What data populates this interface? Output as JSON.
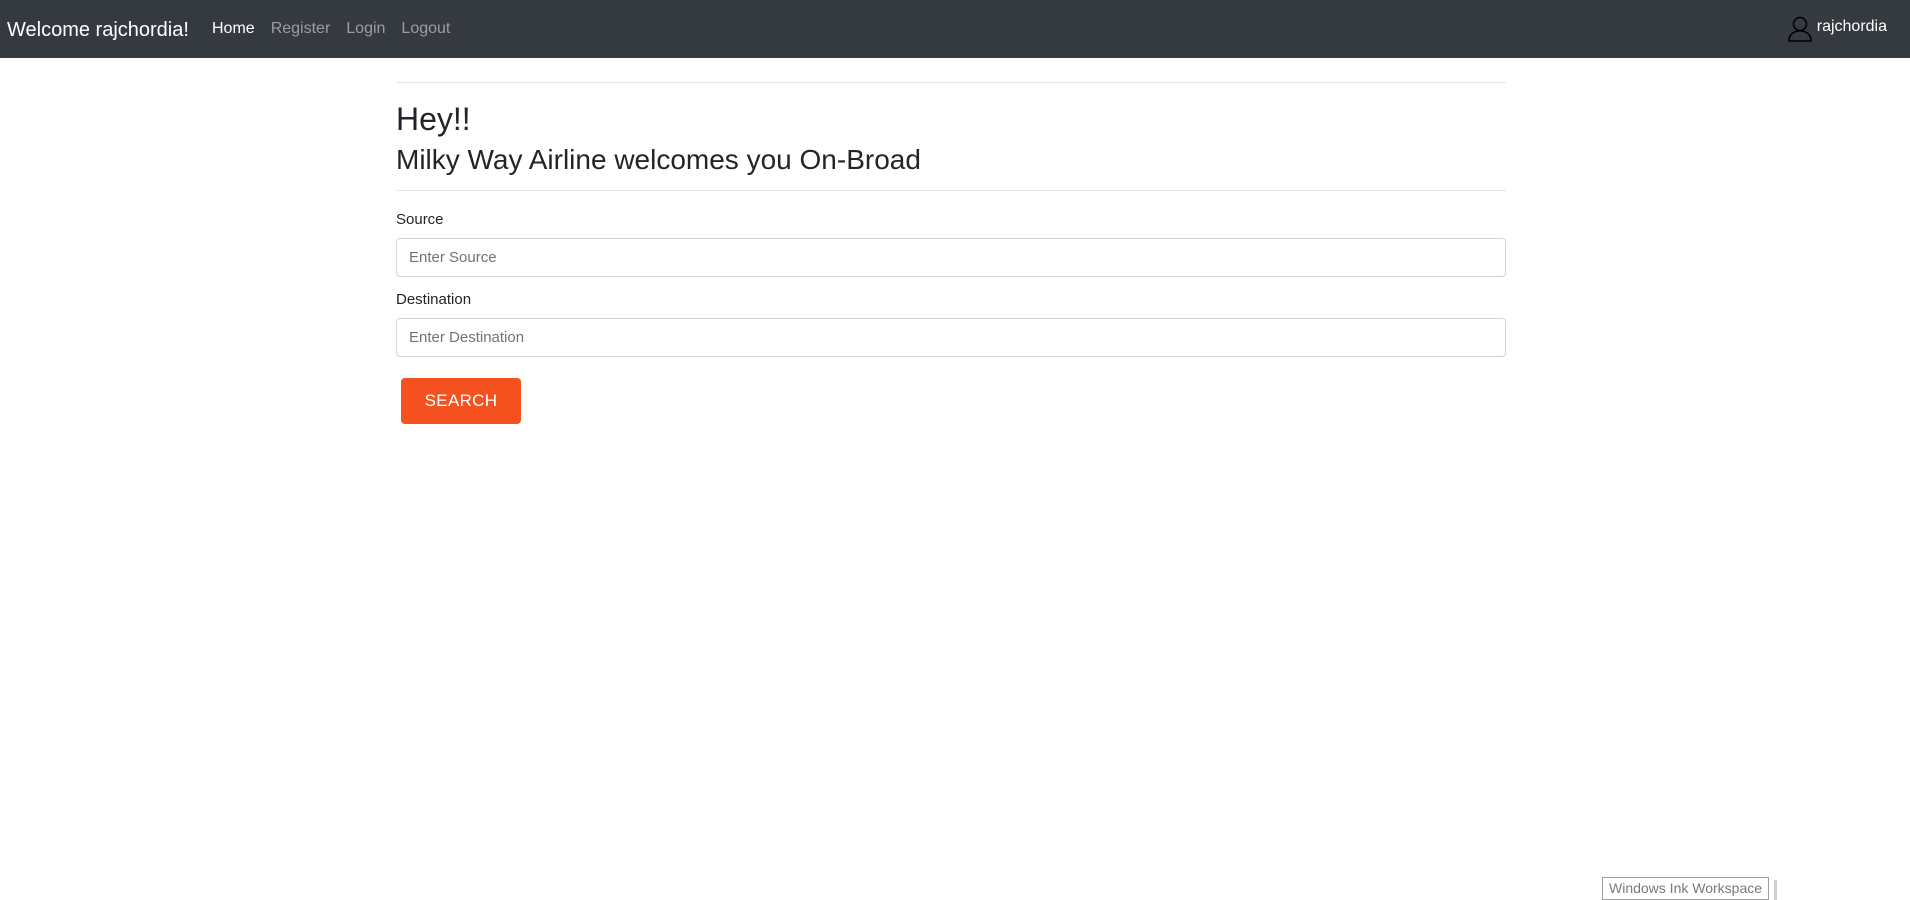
{
  "navbar": {
    "brand": "Welcome rajchordia!",
    "links": [
      {
        "label": "Home",
        "active": true
      },
      {
        "label": "Register",
        "active": false
      },
      {
        "label": "Login",
        "active": false
      },
      {
        "label": "Logout",
        "active": false
      }
    ],
    "user": {
      "icon": "user-icon",
      "name": "rajchordia"
    }
  },
  "main": {
    "greeting": "Hey!!",
    "welcome": "Milky Way Airline welcomes you On-Broad",
    "form": {
      "source": {
        "label": "Source",
        "placeholder": "Enter Source",
        "value": ""
      },
      "destination": {
        "label": "Destination",
        "placeholder": "Enter Destination",
        "value": ""
      },
      "search_label": "SEARCH"
    }
  },
  "taskbar_tooltip": {
    "text": "Windows Ink Workspace"
  },
  "colors": {
    "navbar_bg": "#343a40",
    "search_button": "#f4511e",
    "nav_active": "#ffffff",
    "nav_inactive": "#9a9da0"
  }
}
